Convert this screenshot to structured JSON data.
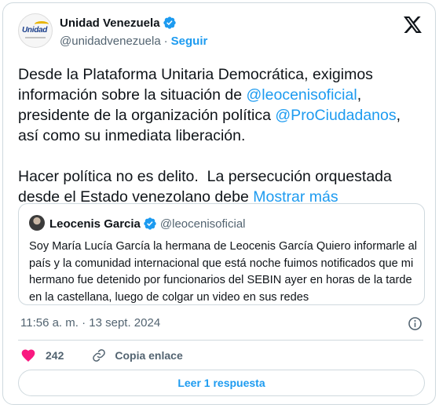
{
  "author": {
    "display_name": "Unidad Venezuela",
    "handle": "@unidadvenezuela",
    "separator": "·",
    "follow_label": "Seguir",
    "avatar_logo_text": "Unidad"
  },
  "tweet": {
    "line1": "Desde la Plataforma Unitaria Democrática, exigimos",
    "line2_prefix": "información sobre la situación de ",
    "mention1": "@leocenisoficial",
    "line2_suffix": ",",
    "line3_prefix": "presidente de la organización política ",
    "mention2": "@ProCiudadanos",
    "line3_suffix": ",",
    "line4": "así como su inmediata liberación.",
    "line5": "Hacer política no es delito.  La persecución orquestada",
    "line6_prefix": "desde el Estado venezolano debe ",
    "show_more": "Mostrar más"
  },
  "quote": {
    "display_name": "Leocenis Garcia",
    "handle": "@leocenisoficial",
    "text": "Soy María Lucía García la hermana de Leocenis García Quiero informarle al país y la comunidad internacional que está noche fuimos notificados que mi hermano fue detenido por funcionarios del SEBIN ayer en horas de la tarde en la castellana, luego de colgar un video en sus redes"
  },
  "meta": {
    "timestamp": "11:56 a. m. · 13 sept. 2024"
  },
  "actions": {
    "like_count": "242",
    "copy_link_label": "Copia enlace"
  },
  "replies": {
    "button_label": "Leer 1 respuesta"
  },
  "colors": {
    "accent": "#1d9bf0",
    "like": "#f91880",
    "muted": "#536471",
    "border": "#cfd9de"
  },
  "icons": [
    "verified-badge-icon",
    "x-logo-icon",
    "info-icon",
    "heart-icon",
    "link-icon"
  ]
}
